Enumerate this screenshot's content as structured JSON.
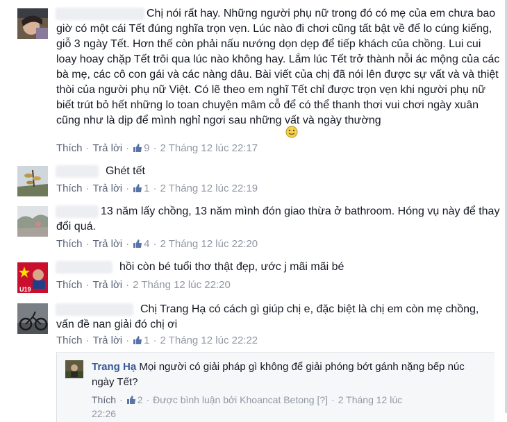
{
  "comments": [
    {
      "text": "Chị nói rất hay. Những người phụ nữ trong đó có mẹ của em chưa bao giờ có một cái Tết đúng nghĩa trọn vẹn. Lúc nào đi chơi cũng tất bật về để lo cúng kiếng, giỗ 3 ngày Tết. Hơn thế còn phải nấu nướng dọn dẹp để tiếp khách của chồng. Lui cui loay hoay chặp Tết trôi qua lúc nào không hay. Lắm lúc Tết trở thành nỗi ác mộng của các bà mẹ, các cô con gái và các nàng dâu. Bài viết của chị đã nói lên được sự vất và và thiệt thòi của người phụ nữ Việt. Có lẽ theo em nghĩ Tết chỉ được trọn vẹn khi người phụ nữ biết trút bỏ hết những lo toan chuyện mâm cỗ để có thể thanh thơi vui chơi ngày xuân cũng như là dịp để mình nghỉ ngơi sau những vất và ngày thường",
      "like": "Thích",
      "reply": "Trả lời",
      "likes": "9",
      "time": "2 Tháng 12 lúc 22:17"
    },
    {
      "text": "Ghét tết",
      "like": "Thích",
      "reply": "Trả lời",
      "likes": "1",
      "time": "2 Tháng 12 lúc 22:19"
    },
    {
      "text": "13 năm lấy chồng, 13 năm mình đón giao thừa ở bathroom. Hóng vụ này để thay đổi quá.",
      "like": "Thích",
      "reply": "Trả lời",
      "likes": "4",
      "time": "2 Tháng 12 lúc 22:20"
    },
    {
      "text": "hồi còn bé tuổi thơ thật đẹp, ước j mãi mãi bé",
      "like": "Thích",
      "reply": "Trả lời",
      "time": "2 Tháng 12 lúc 22:20",
      "avatar_text": "U19"
    },
    {
      "text": "Chị Trang Hạ có cách gì giúp chị e, đặc biệt là chị em còn mẹ chồng, vấn đề nan giải đó chị ơi",
      "like": "Thích",
      "reply": "Trả lời",
      "likes": "1",
      "time": "2 Tháng 12 lúc 22:22"
    }
  ],
  "reply": {
    "author": "Trang Hạ",
    "text": "Mọi người có giải pháp gì không để giải phóng bớt gánh nặng bếp núc ngày Tết?",
    "like": "Thích",
    "likes": "2",
    "commented_by": "Được bình luận bởi Khoancat Betong",
    "help": "[?]",
    "time": "2 Tháng 12 lúc",
    "time_cut": "22:26"
  },
  "colors": {
    "link": "#5a6478",
    "meta": "#9197a3",
    "author": "#365899",
    "like_icon": "#5b74a8"
  }
}
